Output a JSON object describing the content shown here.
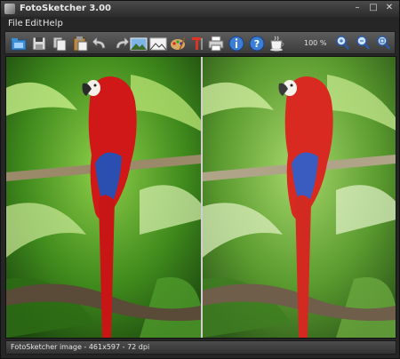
{
  "window": {
    "title": "FotoSketcher 3.00",
    "controls": {
      "minimize": "–",
      "maximize": "□",
      "close": "✕"
    }
  },
  "menu": {
    "items": [
      "File",
      "Edit",
      "Help"
    ]
  },
  "toolbar": {
    "buttons": [
      "open-icon",
      "save-icon",
      "copy-icon",
      "paste-icon",
      "undo-icon",
      "redo-icon",
      "landscape-photo-icon",
      "drawn-landscape-icon",
      "palette-icon",
      "text-icon",
      "print-icon",
      "info-icon",
      "help-icon",
      "coffee-icon",
      "zoom-in-icon",
      "zoom-out-icon",
      "zoom-fit-icon"
    ],
    "zoom_level": "100 %"
  },
  "canvas": {
    "left_pane": "original-photo",
    "right_pane": "painted-effect"
  },
  "status": {
    "text": "FotoSketcher image - 461x597 - 72 dpi"
  },
  "colors": {
    "chrome": "#262626",
    "toolbar": "#4a4a4a",
    "parrot": "#d01818",
    "foliage": "#3f8a1c"
  }
}
